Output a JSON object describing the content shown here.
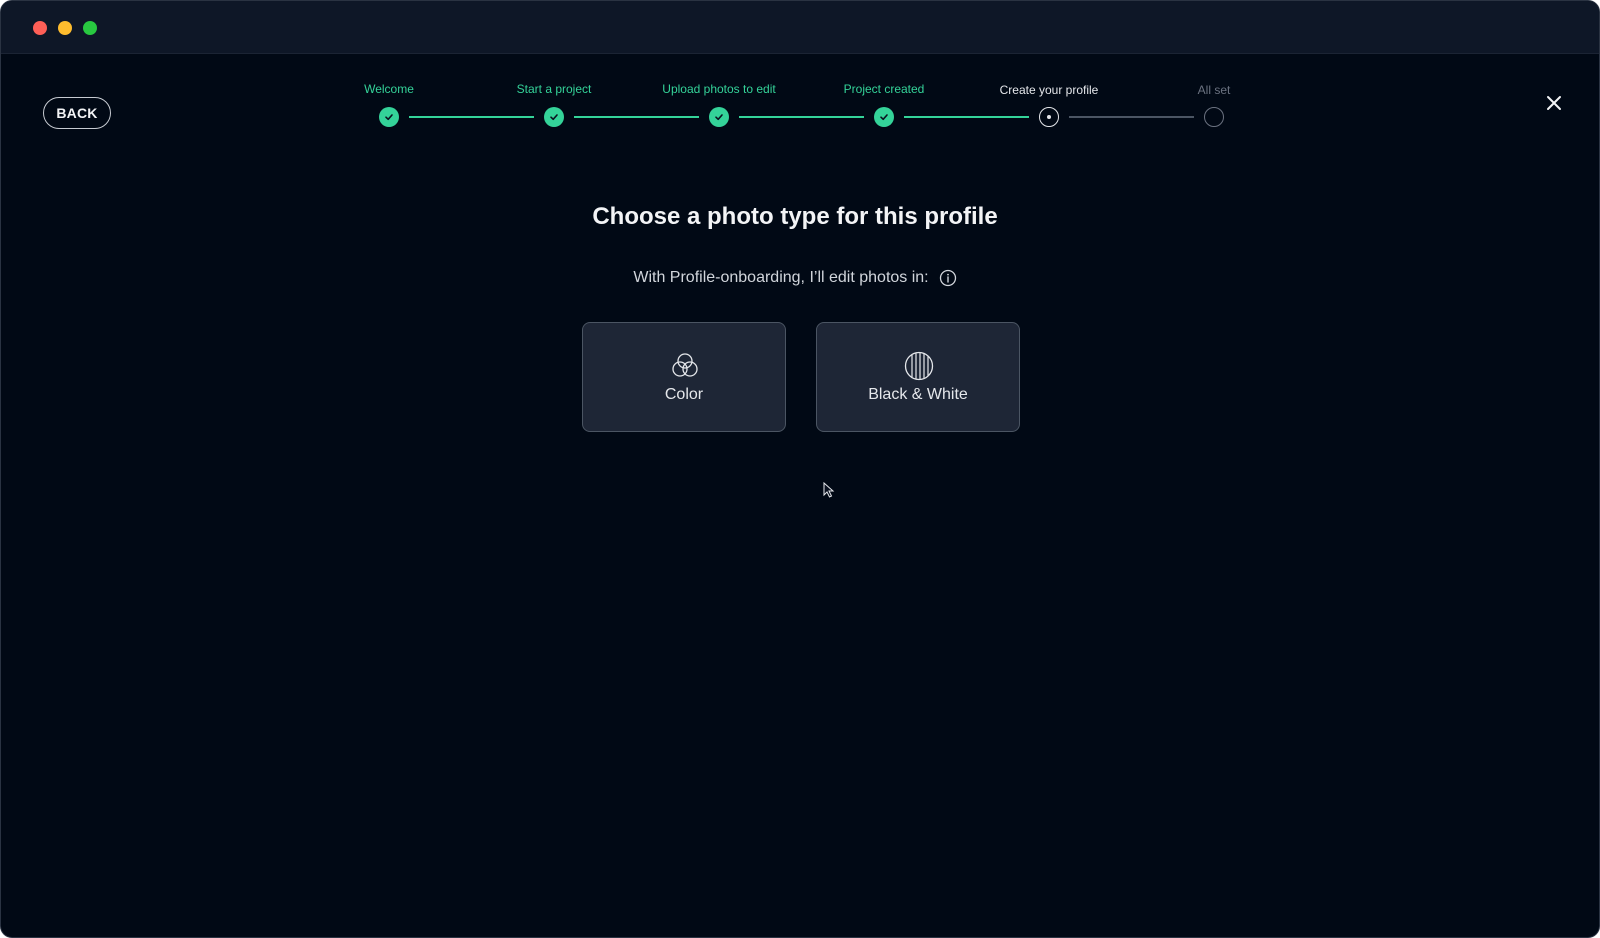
{
  "window": {
    "controls": [
      "close",
      "minimize",
      "zoom"
    ]
  },
  "header": {
    "back_label": "BACK",
    "close_icon": "close-icon"
  },
  "stepper": {
    "steps": [
      {
        "label": "Welcome",
        "status": "done"
      },
      {
        "label": "Start a project",
        "status": "done"
      },
      {
        "label": "Upload photos to edit",
        "status": "done"
      },
      {
        "label": "Project created",
        "status": "done"
      },
      {
        "label": "Create your profile",
        "status": "current"
      },
      {
        "label": "All set",
        "status": "todo"
      }
    ],
    "colors": {
      "done": "#34d399",
      "current": "#e5e7eb",
      "todo": "#6b7280"
    }
  },
  "main": {
    "title": "Choose a photo type for this profile",
    "subtitle": "With Profile-onboarding, I’ll edit photos in:",
    "info_icon": "info-icon",
    "options": [
      {
        "label": "Color",
        "icon": "color-circles-icon"
      },
      {
        "label": "Black & White",
        "icon": "black-white-icon"
      }
    ]
  }
}
